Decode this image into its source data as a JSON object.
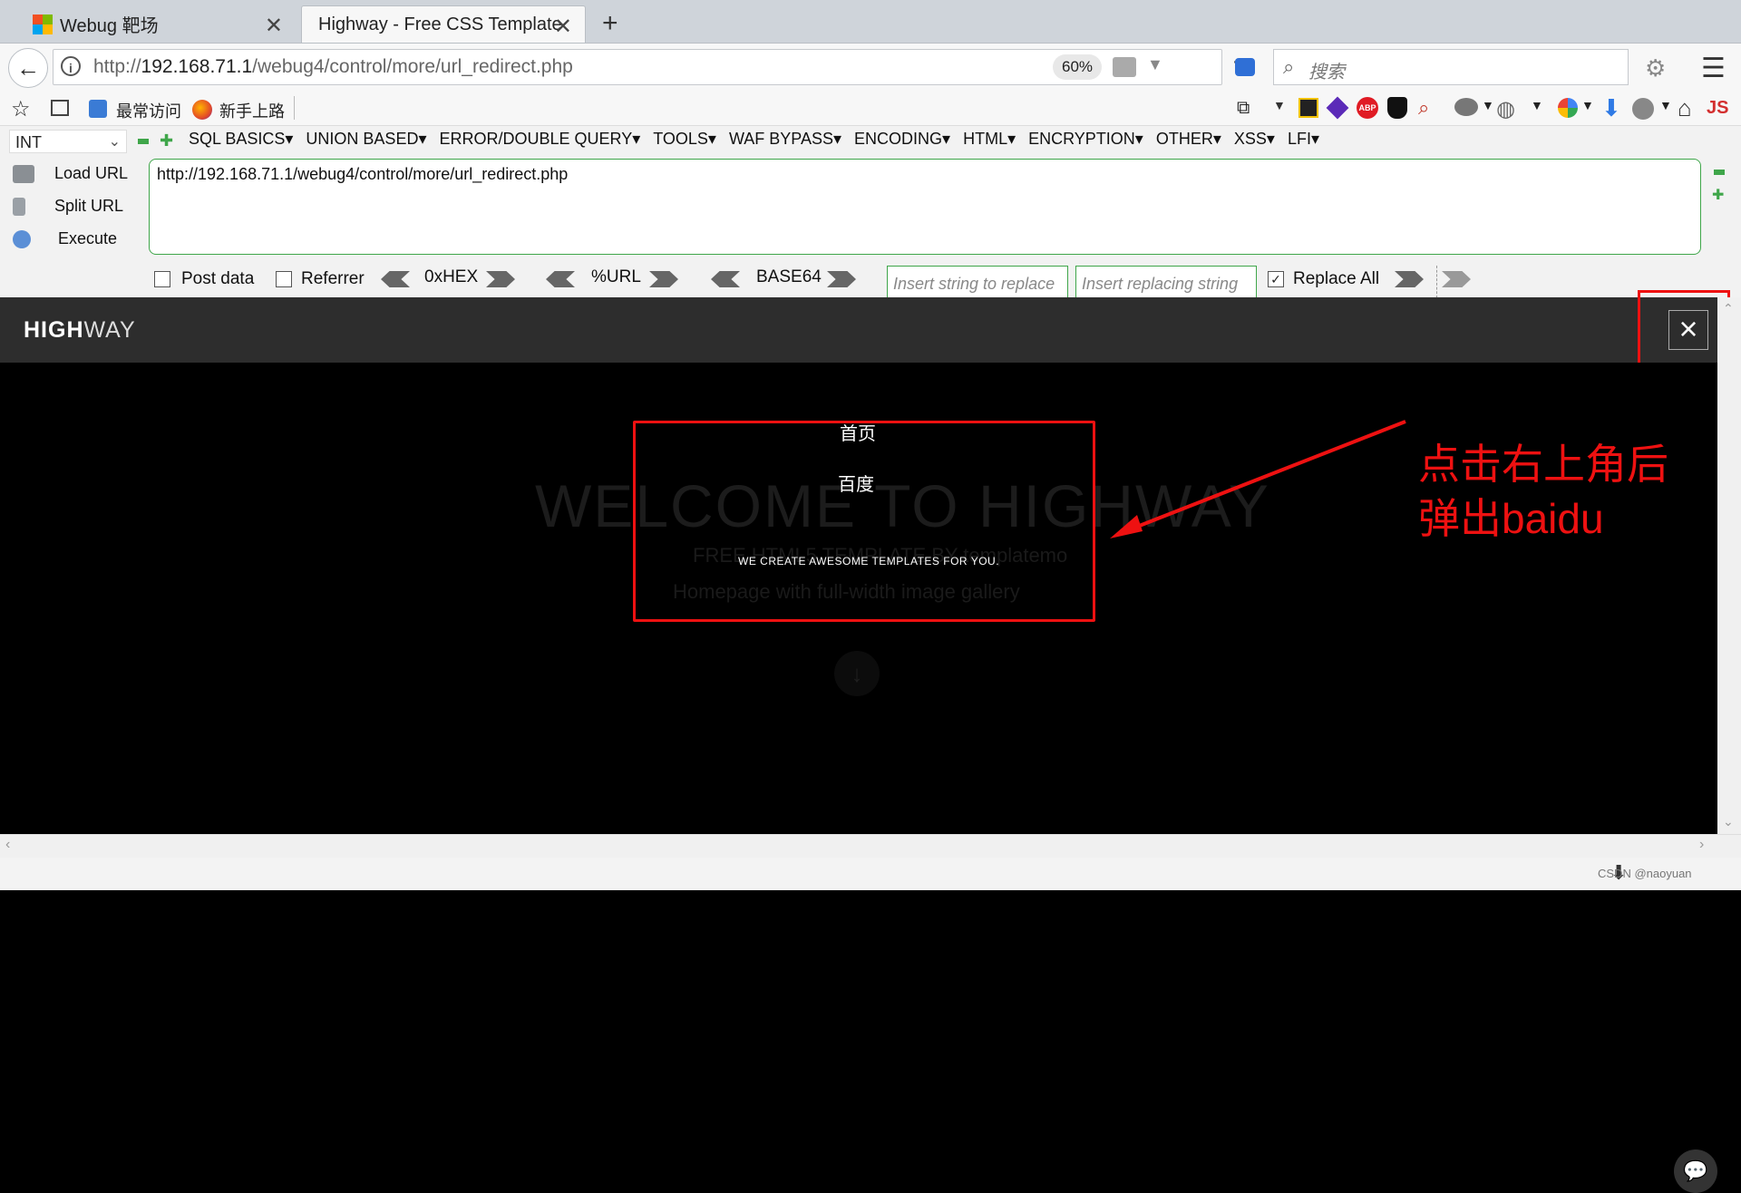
{
  "tabs": [
    {
      "title": "Webug 靶场"
    },
    {
      "title": "Highway - Free CSS Template"
    }
  ],
  "nav": {
    "url_prefix": "http://",
    "url_host": "192.168.71.1",
    "url_path": "/webug4/control/more/url_redirect.php",
    "zoom": "60%",
    "search_placeholder": "搜索"
  },
  "bookmarks": {
    "item1": "最常访问",
    "item2": "新手上路"
  },
  "hackbar": {
    "select_value": "INT",
    "menus": [
      "SQL BASICS▾",
      "UNION BASED▾",
      "ERROR/DOUBLE QUERY▾",
      "TOOLS▾",
      "WAF BYPASS▾",
      "ENCODING▾",
      "HTML▾",
      "ENCRYPTION▾",
      "OTHER▾",
      "XSS▾",
      "LFI▾"
    ],
    "load_url": "Load URL",
    "split_url": "Split URL",
    "execute": "Execute",
    "url_value": "http://192.168.71.1/webug4/control/more/url_redirect.php",
    "post_data": "Post data",
    "referrer": "Referrer",
    "hex": "0xHEX",
    "url_enc": "%URL",
    "base64": "BASE64",
    "insert_placeholder": "Insert string to replace",
    "replacing_placeholder": "Insert replacing string",
    "replace_all": "Replace All"
  },
  "site": {
    "logo_bold": "HIGH",
    "logo_rest": "WAY",
    "hero_title": "WELCOME TO HIGHWAY",
    "hero_sub1": "FREE HTML5 TEMPLATE BY templatemo",
    "hero_sub2": "Homepage with full-width image gallery",
    "menu_home": "首页",
    "menu_baidu": "百度",
    "menu_tag": "WE CREATE AWESOME TEMPLATES FOR YOU."
  },
  "annotation": {
    "line1": "点击右上角后",
    "line2": "弹出baidu",
    "color": "#ee1111"
  },
  "watermark": "CSDN @naoyuan"
}
